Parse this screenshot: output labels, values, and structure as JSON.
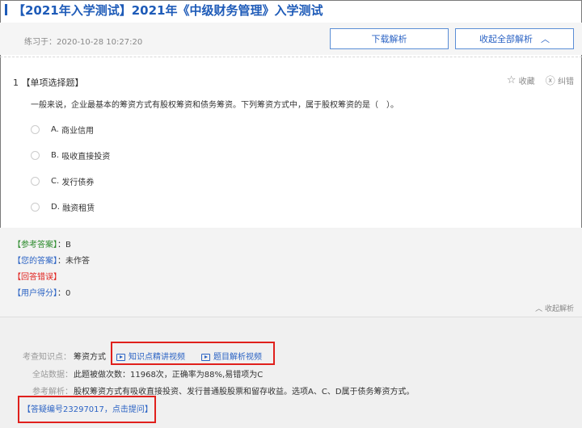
{
  "page": {
    "title": "【2021年入学测试】2021年《中级财务管理》入学测试",
    "practice_time": "练习于：2020-10-28 10:27:20",
    "download_label": "下载解析",
    "collapse_all_label": "收起全部解析",
    "collapse_chevron": "chevron-up-icon"
  },
  "question": {
    "number": "1",
    "type_label": "【单项选择题】",
    "favorite_label": "收藏",
    "report_label": "纠错",
    "stem": "一般来说，企业最基本的筹资方式有股权筹资和债务筹资。下列筹资方式中，属于股权筹资的是（　）。",
    "options": [
      {
        "letter": "A.",
        "text": "商业信用"
      },
      {
        "letter": "B.",
        "text": "吸收直接投资"
      },
      {
        "letter": "C.",
        "text": "发行债券"
      },
      {
        "letter": "D.",
        "text": "融资租赁"
      }
    ]
  },
  "answer": {
    "reference_tag": "【参考答案】",
    "reference_value": "：B",
    "your_tag": "【您的答案】",
    "your_value": "：未作答",
    "result_tag": "【回答错误】",
    "score_tag": "【用户得分】",
    "score_value": "：0",
    "collapse_label": "收起解析"
  },
  "analysis": {
    "knowledge_label": "考查知识点：",
    "knowledge_value": "筹资方式",
    "video1": "知识点精讲视频",
    "video2": "题目解析视频",
    "stats_label": "全站数据：",
    "stats_value": "此题被做次数：11968次，正确率为88%,易错项为C",
    "ref_label": "参考解析：",
    "ref_value": "股权筹资方式有吸收直接投资、发行普通股股票和留存收益。选项A、C、D属于债务筹资方式。",
    "ask_link": "【答疑编号23297017，点击提问】"
  },
  "colors": {
    "accent": "#1e5bb8",
    "link": "#2b63c4",
    "highlight_box": "#e0201c"
  }
}
